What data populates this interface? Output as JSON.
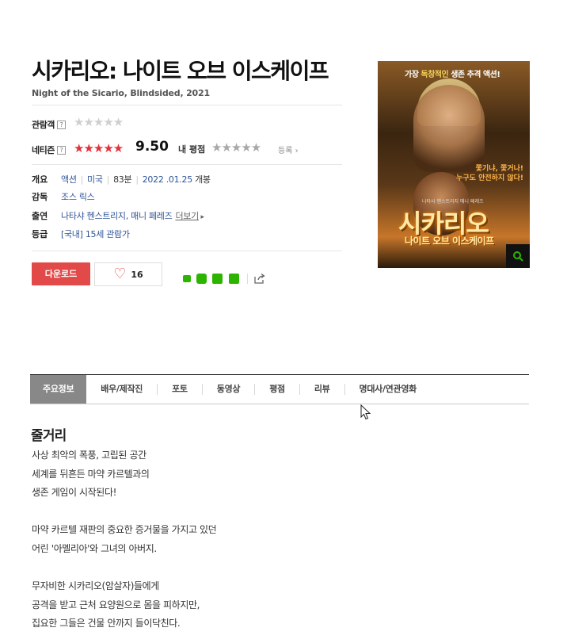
{
  "movie": {
    "title": "시카리오: 나이트 오브 이스케이프",
    "subtitle": "Night of the Sicario, Blindsided, 2021"
  },
  "ratings": {
    "audience_label": "관람객",
    "help": "?",
    "netizen_label": "네티즌",
    "netizen_score": "9.50",
    "my_rating_label": "내 평점",
    "register_label": "등록",
    "stars": "★★★★★"
  },
  "info": {
    "overview_label": "개요",
    "genre": "액션",
    "country": "미국",
    "runtime": "83분",
    "release_date": "2022 .01.25",
    "release_suffix": "개봉",
    "director_label": "감독",
    "director": "조스 릭스",
    "cast_label": "출연",
    "cast": "나타샤 헨스트리지, 매니 페레즈",
    "more_label": "더보기",
    "grade_label": "등급",
    "grade_region": "[국내]",
    "grade": "15세 관람가"
  },
  "actions": {
    "download_label": "다운로드",
    "like_count": "16"
  },
  "poster": {
    "tagline_prefix": "가장",
    "tagline_highlight": "독창적인",
    "tagline_suffix": "생존 추격 액션!",
    "side_text_1": "쫓기냐, 쫓거나!",
    "side_text_2": "누구도 안전하지 않다!",
    "credits": "나타샤 헨스트리지     매니 페레즈",
    "title_big": "시카리오",
    "title_small": "나이트 오브 이스케이프"
  },
  "tabs": [
    {
      "label": "주요정보"
    },
    {
      "label": "배우/제작진"
    },
    {
      "label": "포토"
    },
    {
      "label": "동영상"
    },
    {
      "label": "평점"
    },
    {
      "label": "리뷰"
    },
    {
      "label": "명대사/연관영화"
    }
  ],
  "synopsis": {
    "title": "줄거리",
    "lines": [
      "사상 최악의 폭풍, 고립된 공간",
      "세계를 뒤흔든 마약 카르텔과의",
      "생존 게임이 시작된다!",
      "",
      "마약 카르텔 재판의 중요한 증거물을 가지고 있던",
      "어린 '아멜리아'와 그녀의 아버지.",
      "",
      "무자비한 시카리오(암살자)들에게",
      "공격을 받고 근처 요양원으로 몸을 피하지만,",
      "집요한 그들은 건물 안까지 들이닥친다."
    ]
  },
  "colors": {
    "accent_red": "#e24a4a",
    "link_blue": "#2f5597",
    "share_green": "#2db400"
  }
}
